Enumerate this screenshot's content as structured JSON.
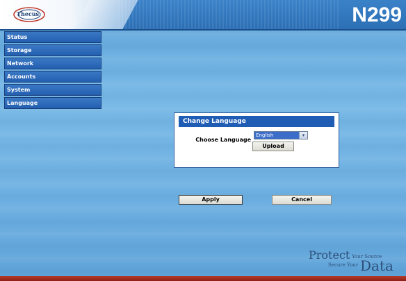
{
  "header": {
    "logo_text": "Thecus",
    "model": "N299"
  },
  "sidebar": {
    "items": [
      {
        "label": "Status"
      },
      {
        "label": "Storage"
      },
      {
        "label": "Network"
      },
      {
        "label": "Accounts"
      },
      {
        "label": "System"
      },
      {
        "label": "Language"
      }
    ]
  },
  "dialog": {
    "title": "Change Language",
    "choose_label": "Choose Language",
    "language_select": {
      "selected": "English"
    },
    "upload_label": "Upload",
    "apply_label": "Apply",
    "cancel_label": "Cancel"
  },
  "tagline": {
    "protect": "Protect",
    "your_source": "Your Source",
    "secure_your": "Secure Your",
    "data": "Data"
  },
  "colors": {
    "header_blue": "#2c6fb5",
    "nav_blue": "#245fb0",
    "dialog_title_blue": "#1f5cb4",
    "bottom_bar_red": "#8e1f14"
  }
}
